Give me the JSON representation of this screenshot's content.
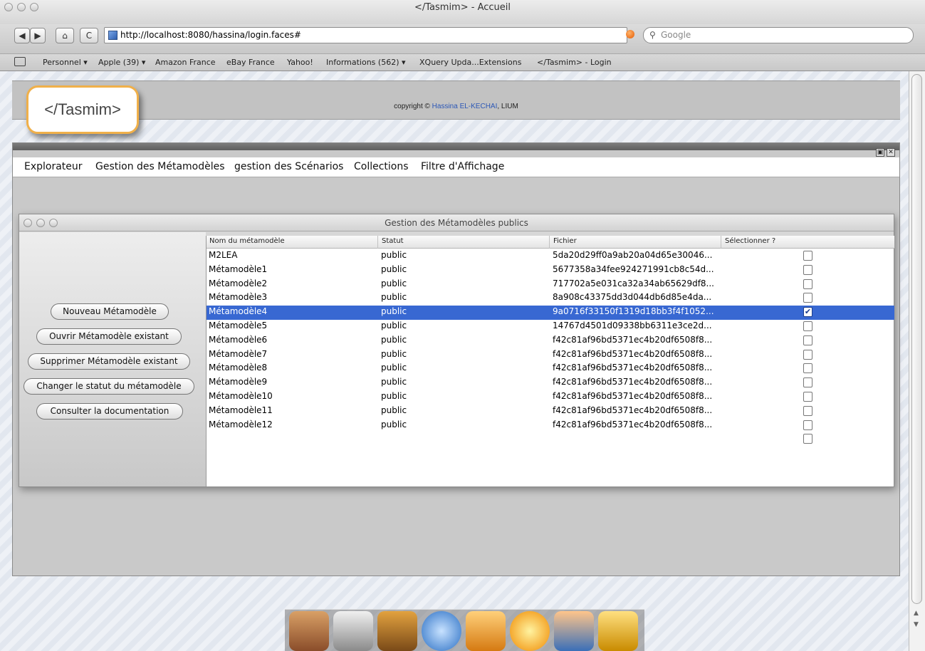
{
  "window": {
    "title": "</Tasmim> - Accueil"
  },
  "toolbar": {
    "back_label": "◀",
    "forward_label": "▶",
    "home_label": "⌂",
    "reload_label": "C",
    "url": "http://localhost:8080/hassina/login.faces#",
    "search_placeholder": "Google"
  },
  "bookmarks": [
    "Personnel ▾",
    "Apple (39) ▾",
    "Amazon France",
    "eBay France",
    "Yahoo!",
    "Informations (562) ▾",
    "XQuery Upda...Extensions",
    "</Tasmim> - Login"
  ],
  "page": {
    "logo_text": "</Tasmim>",
    "copyright_prefix": "copyright ©",
    "copyright_author": "Hassina EL-KECHAI",
    "copyright_suffix": ", LIUM"
  },
  "menu": [
    "Explorateur",
    "Gestion des Métamodèles",
    "gestion des Scénarios",
    "Collections",
    "Filtre d'Affichage"
  ],
  "dialog": {
    "title": "Gestion des Métamodèles publics",
    "buttons": [
      "Nouveau Métamodèle",
      "Ouvrir Métamodèle existant",
      "Supprimer Métamodèle existant",
      "Changer le statut du métamodèle",
      "Consulter la documentation"
    ],
    "columns": [
      "Nom du métamodèle",
      "Statut",
      "Fichier",
      "Sélectionner ?"
    ],
    "rows": [
      {
        "name": "M2LEA",
        "status": "public",
        "file": "5da20d29ff0a9ab20a04d65e30046...",
        "checked": false
      },
      {
        "name": "Métamodèle1",
        "status": "public",
        "file": "5677358a34fee924271991cb8c54d...",
        "checked": false
      },
      {
        "name": "Métamodèle2",
        "status": "public",
        "file": "717702a5e031ca32a34ab65629df8...",
        "checked": false
      },
      {
        "name": "Métamodèle3",
        "status": "public",
        "file": "8a908c43375dd3d044db6d85e4da...",
        "checked": false
      },
      {
        "name": "Métamodèle4",
        "status": "public",
        "file": "9a0716f33150f1319d18bb3f4f1052...",
        "checked": true,
        "selected": true
      },
      {
        "name": "Métamodèle5",
        "status": "public",
        "file": "14767d4501d09338bb6311e3ce2d...",
        "checked": false
      },
      {
        "name": "Métamodèle6",
        "status": "public",
        "file": "f42c81af96bd5371ec4b20df6508f8...",
        "checked": false
      },
      {
        "name": "Métamodèle7",
        "status": "public",
        "file": "f42c81af96bd5371ec4b20df6508f8...",
        "checked": false
      },
      {
        "name": "Métamodèle8",
        "status": "public",
        "file": "f42c81af96bd5371ec4b20df6508f8...",
        "checked": false
      },
      {
        "name": "Métamodèle9",
        "status": "public",
        "file": "f42c81af96bd5371ec4b20df6508f8...",
        "checked": false
      },
      {
        "name": "Métamodèle10",
        "status": "public",
        "file": "f42c81af96bd5371ec4b20df6508f8...",
        "checked": false
      },
      {
        "name": "Métamodèle11",
        "status": "public",
        "file": "f42c81af96bd5371ec4b20df6508f8...",
        "checked": false
      },
      {
        "name": "Métamodèle12",
        "status": "public",
        "file": "f42c81af96bd5371ec4b20df6508f8...",
        "checked": false
      }
    ],
    "extra_checkbox": {
      "checked": false
    }
  },
  "dock": [
    "home-dock-icon",
    "documents-dock-icon",
    "tools-dock-icon",
    "safari-dock-icon",
    "app4-dock-icon",
    "sun-dock-icon",
    "users-dock-icon",
    "lock-dock-icon"
  ],
  "colors": {
    "selection": "#3868d2",
    "logo_border": "#f0b04a",
    "author_link": "#2b57b6"
  }
}
